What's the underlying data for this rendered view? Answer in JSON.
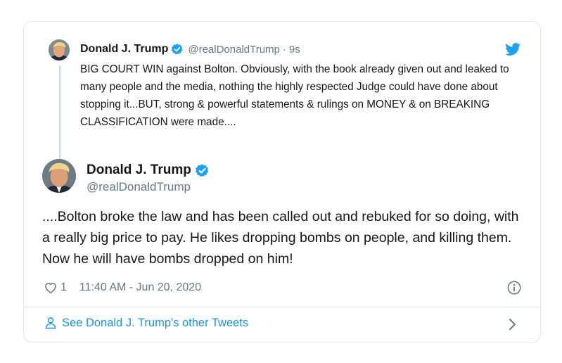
{
  "parent_tweet": {
    "author_name": "Donald J. Trump",
    "handle": "@realDonaldTrump",
    "separator": "·",
    "age": "9s",
    "text": "BIG COURT WIN against Bolton. Obviously, with the book already given out and leaked to many people and the media, nothing the highly respected Judge could have done about stopping it...BUT, strong & powerful statements & rulings on MONEY & on BREAKING CLASSIFICATION were made...."
  },
  "main_tweet": {
    "author_name": "Donald J. Trump",
    "handle": "@realDonaldTrump",
    "text": "....Bolton broke the law and has been called out and rebuked for so doing, with a really big price to pay. He likes dropping bombs on people, and killing them. Now he will have bombs dropped on him!",
    "like_count": "1",
    "timestamp": "11:40 AM - Jun 20, 2020"
  },
  "footer": {
    "link_label": "See Donald J. Trump's other Tweets"
  },
  "icons": {
    "verified": "verified-badge-icon",
    "brand": "twitter-bird-icon",
    "like": "heart-icon",
    "info": "info-icon",
    "profile": "person-icon",
    "more": "chevron-right-icon"
  },
  "colors": {
    "accent": "#1da1f2",
    "link": "#1b95e0",
    "secondary_text": "#657786",
    "border": "#e1e8ed"
  }
}
